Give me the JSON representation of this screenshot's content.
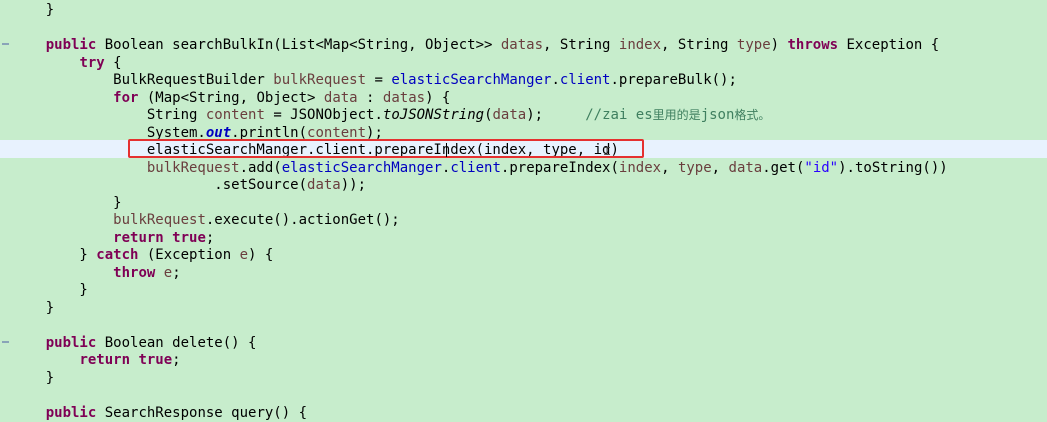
{
  "editor": {
    "accent_box_color": "#e53030",
    "lines": [
      [
        {
          "t": "    }",
          "c": ""
        }
      ],
      [
        {
          "t": "",
          "c": ""
        }
      ],
      [
        {
          "t": "    ",
          "c": ""
        },
        {
          "t": "public",
          "c": "kw"
        },
        {
          "t": " Boolean searchBulkIn(List<Map<String, Object>> ",
          "c": ""
        },
        {
          "t": "datas",
          "c": "param"
        },
        {
          "t": ", String ",
          "c": ""
        },
        {
          "t": "index",
          "c": "param"
        },
        {
          "t": ", String ",
          "c": ""
        },
        {
          "t": "type",
          "c": "param"
        },
        {
          "t": ") ",
          "c": ""
        },
        {
          "t": "throws",
          "c": "kw"
        },
        {
          "t": " Exception {",
          "c": ""
        }
      ],
      [
        {
          "t": "        ",
          "c": ""
        },
        {
          "t": "try",
          "c": "kw"
        },
        {
          "t": " {",
          "c": ""
        }
      ],
      [
        {
          "t": "            BulkRequestBuilder ",
          "c": ""
        },
        {
          "t": "bulkRequest",
          "c": "param"
        },
        {
          "t": " = ",
          "c": ""
        },
        {
          "t": "elasticSearchManger",
          "c": "fld"
        },
        {
          "t": ".",
          "c": ""
        },
        {
          "t": "client",
          "c": "fld"
        },
        {
          "t": ".prepareBulk();",
          "c": ""
        }
      ],
      [
        {
          "t": "            ",
          "c": ""
        },
        {
          "t": "for",
          "c": "kw"
        },
        {
          "t": " (Map<String, Object> ",
          "c": ""
        },
        {
          "t": "data",
          "c": "param"
        },
        {
          "t": " : ",
          "c": ""
        },
        {
          "t": "datas",
          "c": "param"
        },
        {
          "t": ") {",
          "c": ""
        }
      ],
      [
        {
          "t": "                String ",
          "c": ""
        },
        {
          "t": "content",
          "c": "param"
        },
        {
          "t": " = JSONObject.",
          "c": ""
        },
        {
          "t": "toJSONString",
          "c": "static-m"
        },
        {
          "t": "(",
          "c": ""
        },
        {
          "t": "data",
          "c": "param"
        },
        {
          "t": ");     ",
          "c": ""
        },
        {
          "t": "//zai es",
          "c": "cmt"
        },
        {
          "t": "里用的是",
          "c": "cmt cjk"
        },
        {
          "t": "json",
          "c": "cmt"
        },
        {
          "t": "格式。",
          "c": "cmt cjk"
        }
      ],
      [
        {
          "t": "                System.",
          "c": ""
        },
        {
          "t": "out",
          "c": "static-fld"
        },
        {
          "t": ".println(",
          "c": ""
        },
        {
          "t": "content",
          "c": "param"
        },
        {
          "t": ");",
          "c": ""
        }
      ],
      [
        {
          "t": "                elasticSearchManger.client.prepareIndex(index, type, id)",
          "c": ""
        }
      ],
      [
        {
          "t": "                ",
          "c": ""
        },
        {
          "t": "bulkRequest",
          "c": "param"
        },
        {
          "t": ".add(",
          "c": ""
        },
        {
          "t": "elasticSearchManger",
          "c": "fld"
        },
        {
          "t": ".",
          "c": ""
        },
        {
          "t": "client",
          "c": "fld"
        },
        {
          "t": ".prepareIndex(",
          "c": ""
        },
        {
          "t": "index",
          "c": "param"
        },
        {
          "t": ", ",
          "c": ""
        },
        {
          "t": "type",
          "c": "param"
        },
        {
          "t": ", ",
          "c": ""
        },
        {
          "t": "data",
          "c": "param"
        },
        {
          "t": ".get(",
          "c": ""
        },
        {
          "t": "\"id\"",
          "c": "str"
        },
        {
          "t": ").toString())",
          "c": ""
        }
      ],
      [
        {
          "t": "                        .setSource(",
          "c": ""
        },
        {
          "t": "data",
          "c": "param"
        },
        {
          "t": "));",
          "c": ""
        }
      ],
      [
        {
          "t": "            }",
          "c": ""
        }
      ],
      [
        {
          "t": "            ",
          "c": ""
        },
        {
          "t": "bulkRequest",
          "c": "param"
        },
        {
          "t": ".execute().actionGet();",
          "c": ""
        }
      ],
      [
        {
          "t": "            ",
          "c": ""
        },
        {
          "t": "return",
          "c": "kw"
        },
        {
          "t": " ",
          "c": ""
        },
        {
          "t": "true",
          "c": "kw"
        },
        {
          "t": ";",
          "c": ""
        }
      ],
      [
        {
          "t": "        } ",
          "c": ""
        },
        {
          "t": "catch",
          "c": "kw"
        },
        {
          "t": " (Exception ",
          "c": ""
        },
        {
          "t": "e",
          "c": "param"
        },
        {
          "t": ") {",
          "c": ""
        }
      ],
      [
        {
          "t": "            ",
          "c": ""
        },
        {
          "t": "throw",
          "c": "kw"
        },
        {
          "t": " ",
          "c": ""
        },
        {
          "t": "e",
          "c": "param"
        },
        {
          "t": ";",
          "c": ""
        }
      ],
      [
        {
          "t": "        }",
          "c": ""
        }
      ],
      [
        {
          "t": "    }",
          "c": ""
        }
      ],
      [
        {
          "t": "",
          "c": ""
        }
      ],
      [
        {
          "t": "    ",
          "c": ""
        },
        {
          "t": "public",
          "c": "kw"
        },
        {
          "t": " Boolean delete() {",
          "c": ""
        }
      ],
      [
        {
          "t": "        ",
          "c": ""
        },
        {
          "t": "return",
          "c": "kw"
        },
        {
          "t": " ",
          "c": ""
        },
        {
          "t": "true",
          "c": "kw"
        },
        {
          "t": ";",
          "c": ""
        }
      ],
      [
        {
          "t": "    }",
          "c": ""
        }
      ],
      [
        {
          "t": "",
          "c": ""
        }
      ],
      [
        {
          "t": "    ",
          "c": ""
        },
        {
          "t": "public",
          "c": "kw"
        },
        {
          "t": " SearchResponse query() {",
          "c": ""
        }
      ]
    ]
  }
}
